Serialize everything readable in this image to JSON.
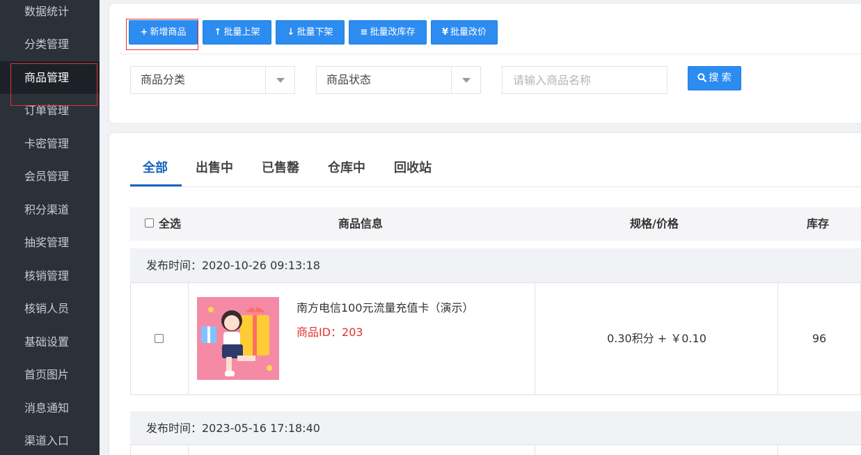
{
  "sidebar": {
    "items": [
      {
        "label": "数据统计"
      },
      {
        "label": "分类管理"
      },
      {
        "label": "商品管理"
      },
      {
        "label": "订单管理"
      },
      {
        "label": "卡密管理"
      },
      {
        "label": "会员管理"
      },
      {
        "label": "积分渠道"
      },
      {
        "label": "抽奖管理"
      },
      {
        "label": "核销管理"
      },
      {
        "label": "核销人员"
      },
      {
        "label": "基础设置"
      },
      {
        "label": "首页图片"
      },
      {
        "label": "消息通知"
      },
      {
        "label": "渠道入口"
      }
    ],
    "active_index": 2
  },
  "toolbar": {
    "add": {
      "icon": "+",
      "label": "新增商品"
    },
    "shelf_up": {
      "icon": "↑",
      "label": "批量上架"
    },
    "shelf_down": {
      "icon": "↓",
      "label": "批量下架"
    },
    "stock": {
      "icon": "≡",
      "label": "批量改库存"
    },
    "price": {
      "icon": "¥",
      "label": "批量改价"
    }
  },
  "filters": {
    "category": "商品分类",
    "status": "商品状态",
    "search_placeholder": "请输入商品名称",
    "search_button": "搜 索"
  },
  "tabs": [
    "全部",
    "出售中",
    "已售罄",
    "仓库中",
    "回收站"
  ],
  "table": {
    "headers": {
      "select_all": "全选",
      "info": "商品信息",
      "spec": "规格/价格",
      "stock": "库存"
    },
    "groups": [
      {
        "publish_time": "发布时间：2020-10-26 09:13:18",
        "product": {
          "name": "南方电信100元流量充值卡（演示）",
          "id_text": "商品ID：203",
          "price": "0.30积分 + ￥0.10",
          "stock": "96"
        }
      },
      {
        "publish_time": "发布时间：2023-05-16 17:18:40"
      }
    ]
  }
}
